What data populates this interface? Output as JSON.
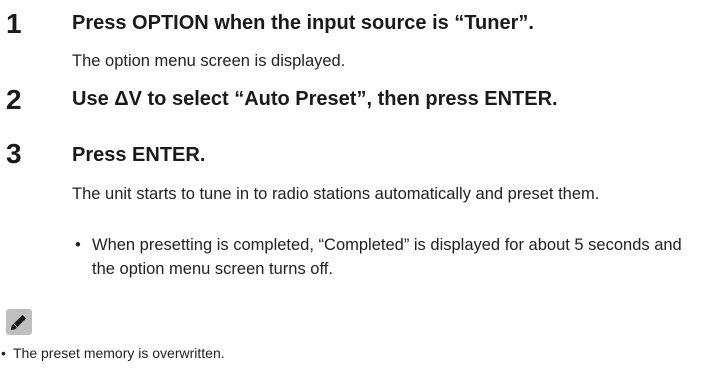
{
  "steps": [
    {
      "number": "1",
      "title": "Press OPTION when the input source is “Tuner”.",
      "body": "The option menu screen is displayed."
    },
    {
      "number": "2",
      "title": "Use ΔV to select “Auto Preset”, then press ENTER."
    },
    {
      "number": "3",
      "title": "Press ENTER.",
      "body": "The unit starts to tune in to radio stations automatically and preset them.",
      "bullets": [
        "When presetting is completed, “Completed” is displayed for about 5 seconds and the option menu screen turns off."
      ]
    }
  ],
  "note": {
    "icon": "pencil-icon",
    "bullets": [
      "The preset memory is overwritten."
    ]
  },
  "bullet_symbol": "•"
}
